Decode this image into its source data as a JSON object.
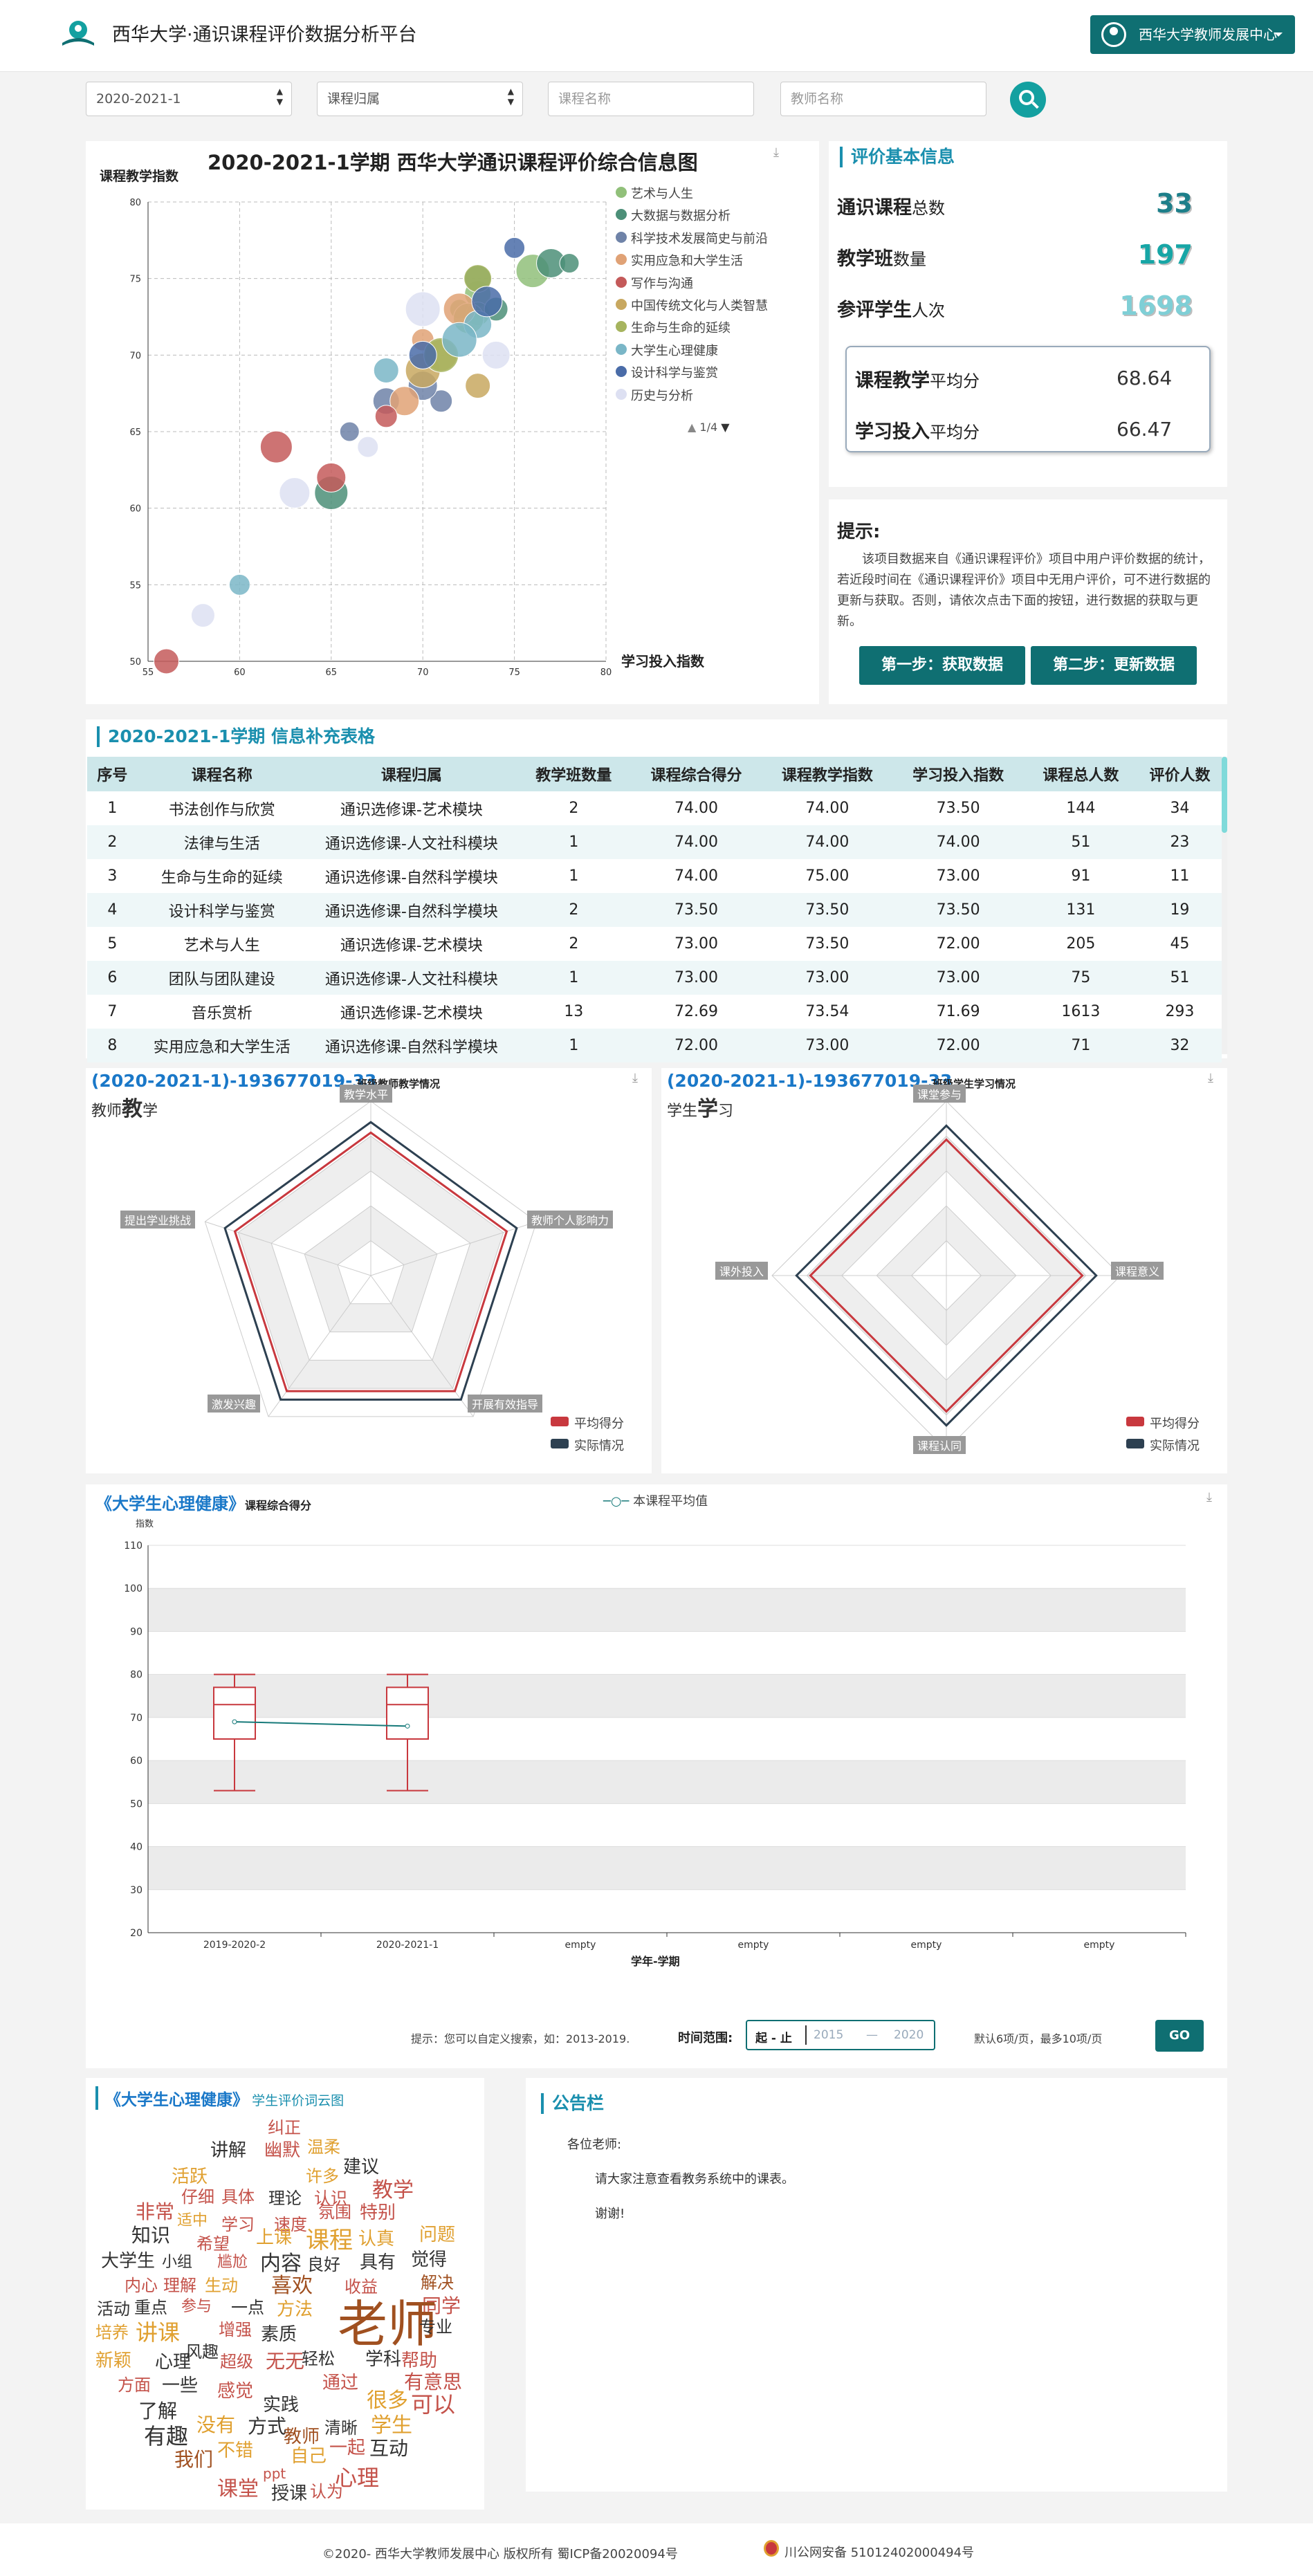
{
  "app": {
    "title": "西华大学·通识课程评价数据分析平台",
    "user_menu": "西华大学教师发展中心"
  },
  "filters": {
    "term": "2020-2021-1",
    "category": "课程归属",
    "course_placeholder": "课程名称",
    "teacher_placeholder": "教师名称"
  },
  "bubble": {
    "title": "2020-2021-1学期 西华大学通识课程评价综合信息图",
    "ylabel": "课程教学指数",
    "xlabel": "学习投入指数",
    "page": "1/4",
    "legend": [
      {
        "name": "艺术与人生",
        "color": "#91c07a"
      },
      {
        "name": "大数据与数据分析",
        "color": "#4c8f78"
      },
      {
        "name": "科学技术发展简史与前沿",
        "color": "#6f83a8"
      },
      {
        "name": "实用应急和大学生活",
        "color": "#e0a276"
      },
      {
        "name": "写作与沟通",
        "color": "#c45a5a"
      },
      {
        "name": "中国传统文化与人类智慧",
        "color": "#c8a860"
      },
      {
        "name": "生命与生命的延续",
        "color": "#a6b45e"
      },
      {
        "name": "大学生心理健康",
        "color": "#7ab6c7"
      },
      {
        "name": "设计科学与鉴赏",
        "color": "#4a6ca8"
      },
      {
        "name": "历史与分析",
        "color": "#dde0f2"
      }
    ],
    "xticks": [
      "55",
      "60",
      "65",
      "70",
      "75",
      "80"
    ],
    "yticks": [
      "50",
      "55",
      "60",
      "65",
      "70",
      "75",
      "80"
    ]
  },
  "chart_data": [
    {
      "type": "scatter",
      "title": "2020-2021-1学期 西华大学通识课程评价综合信息图",
      "xlabel": "学习投入指数",
      "ylabel": "课程教学指数",
      "xlim": [
        55,
        80
      ],
      "ylim": [
        50,
        80
      ],
      "series": [
        {
          "name": "艺术与人生",
          "values": [
            [
              72,
              73
            ],
            [
              73,
              74
            ],
            [
              76,
              75.5
            ],
            [
              73,
              72.7
            ],
            [
              72.5,
              72.4
            ]
          ]
        },
        {
          "name": "大数据与数据分析",
          "values": [
            [
              77,
              76
            ],
            [
              78,
              76
            ],
            [
              73,
              75
            ],
            [
              65,
              61
            ],
            [
              74,
              73
            ]
          ]
        },
        {
          "name": "科学技术发展简史与前沿",
          "values": [
            [
              71,
              67
            ],
            [
              70,
              68
            ],
            [
              66,
              65
            ],
            [
              68,
              67
            ]
          ]
        },
        {
          "name": "实用应急和大学生活",
          "values": [
            [
              72,
              73
            ],
            [
              70,
              71
            ],
            [
              69,
              67
            ]
          ]
        },
        {
          "name": "写作与沟通",
          "values": [
            [
              56,
              50
            ],
            [
              62,
              64
            ],
            [
              68,
              66
            ],
            [
              65,
              62
            ]
          ]
        },
        {
          "name": "中国传统文化与人类智慧",
          "values": [
            [
              70,
              69
            ],
            [
              73,
              68
            ],
            [
              71,
              70
            ]
          ]
        },
        {
          "name": "生命与生命的延续",
          "values": [
            [
              73,
              75
            ],
            [
              71,
              70
            ]
          ]
        },
        {
          "name": "大学生心理健康",
          "values": [
            [
              60,
              55
            ],
            [
              73,
              72
            ],
            [
              72,
              71
            ],
            [
              68,
              69
            ]
          ]
        },
        {
          "name": "设计科学与鉴赏",
          "values": [
            [
              73.5,
              73.5
            ],
            [
              75,
              77
            ],
            [
              70,
              70
            ]
          ]
        },
        {
          "name": "历史与分析",
          "values": [
            [
              58,
              53
            ],
            [
              63,
              61
            ],
            [
              67,
              64
            ],
            [
              74,
              70
            ],
            [
              70,
              73
            ]
          ]
        }
      ]
    },
    {
      "type": "radar",
      "title": "班级教师教学情况",
      "indicators": [
        "教学水平",
        "教师个人影响力",
        "开展有效指导",
        "激发兴趣",
        "提出学业挑战"
      ],
      "series": [
        {
          "name": "平均得分",
          "values": [
            0.82,
            0.82,
            0.82,
            0.82,
            0.82
          ]
        },
        {
          "name": "实际情况",
          "values": [
            0.88,
            0.88,
            0.88,
            0.88,
            0.88
          ]
        }
      ]
    },
    {
      "type": "radar",
      "title": "班级学生学习情况",
      "indicators": [
        "课堂参与",
        "课程意义",
        "课程认同",
        "课外投入"
      ],
      "series": [
        {
          "name": "平均得分",
          "values": [
            0.78,
            0.78,
            0.78,
            0.78
          ]
        },
        {
          "name": "实际情况",
          "values": [
            0.86,
            0.86,
            0.86,
            0.86
          ]
        }
      ]
    },
    {
      "type": "box",
      "title": "课程综合得分",
      "categories": [
        "2019-2020-2",
        "2020-2021-1",
        "empty",
        "empty",
        "empty",
        "empty"
      ],
      "ylim": [
        20,
        110
      ],
      "boxes": [
        {
          "min": 53,
          "q1": 65,
          "median": 73,
          "q3": 77,
          "max": 80
        },
        {
          "min": 53,
          "q1": 65,
          "median": 73,
          "q3": 77,
          "max": 80
        }
      ],
      "series": [
        {
          "name": "本课程平均值",
          "values": [
            69,
            68
          ]
        }
      ]
    }
  ],
  "basic_info": {
    "title": "评价基本信息",
    "rows": [
      {
        "label": "通识课程",
        "suffix": "总数",
        "value": "33",
        "color": "#1d7f8a"
      },
      {
        "label": "教学班",
        "suffix": "数量",
        "value": "197",
        "color": "#17a6a6"
      },
      {
        "label": "参评学生",
        "suffix": "人次",
        "value": "1698",
        "color": "#7fcfd6"
      }
    ],
    "avg": [
      {
        "label": "课程教学",
        "suffix": "平均分",
        "value": "68.64"
      },
      {
        "label": "学习投入",
        "suffix": "平均分",
        "value": "66.47"
      }
    ]
  },
  "tip": {
    "title": "提示:",
    "text": "该项目数据来自《通识课程评价》项目中用户评价数据的统计，若近段时间在《通识课程评价》项目中无用户评价，可不进行数据的更新与获取。否则，请依次点击下面的按钮，进行数据的获取与更新。",
    "btn1": "第一步：获取数据",
    "btn2": "第二步：更新数据"
  },
  "table": {
    "title": "2020-2021-1学期 信息补充表格",
    "headers": [
      "序号",
      "课程名称",
      "课程归属",
      "教学班数量",
      "课程综合得分",
      "课程教学指数",
      "学习投入指数",
      "课程总人数",
      "评价人数"
    ],
    "rows": [
      [
        "1",
        "书法创作与欣赏",
        "通识选修课-艺术模块",
        "2",
        "74.00",
        "74.00",
        "73.50",
        "144",
        "34"
      ],
      [
        "2",
        "法律与生活",
        "通识选修课-人文社科模块",
        "1",
        "74.00",
        "74.00",
        "74.00",
        "51",
        "23"
      ],
      [
        "3",
        "生命与生命的延续",
        "通识选修课-自然科学模块",
        "1",
        "74.00",
        "75.00",
        "73.00",
        "91",
        "11"
      ],
      [
        "4",
        "设计科学与鉴赏",
        "通识选修课-自然科学模块",
        "2",
        "73.50",
        "73.50",
        "73.50",
        "131",
        "19"
      ],
      [
        "5",
        "艺术与人生",
        "通识选修课-艺术模块",
        "2",
        "73.00",
        "73.50",
        "72.00",
        "205",
        "45"
      ],
      [
        "6",
        "团队与团队建设",
        "通识选修课-人文社科模块",
        "1",
        "73.00",
        "73.00",
        "73.00",
        "75",
        "51"
      ],
      [
        "7",
        "音乐赏析",
        "通识选修课-艺术模块",
        "13",
        "72.69",
        "73.54",
        "71.69",
        "1613",
        "293"
      ],
      [
        "8",
        "实用应急和大学生活",
        "通识选修课-自然科学模块",
        "1",
        "72.00",
        "73.00",
        "72.00",
        "71",
        "32"
      ]
    ]
  },
  "radar1": {
    "title": "(2020-2021-1)-193677019-33",
    "subtitle": "班级教师教学情况",
    "caption_pre": "教师",
    "caption_big": "教",
    "caption_post": "学",
    "labels": [
      "教学水平",
      "教师个人影响力",
      "开展有效指导",
      "激发兴趣",
      "提出学业挑战"
    ]
  },
  "radar2": {
    "title": "(2020-2021-1)-193677019-33",
    "subtitle": "班级学生学习情况",
    "caption_pre": "学生",
    "caption_big": "学",
    "caption_post": "习",
    "labels": [
      "课堂参与",
      "课程意义",
      "课程认同",
      "课外投入"
    ]
  },
  "radar_legend": [
    {
      "name": "平均得分",
      "color": "#c8383e"
    },
    {
      "name": "实际情况",
      "color": "#2d4051"
    }
  ],
  "box": {
    "title": "《大学生心理健康》",
    "subtitle": "课程综合得分",
    "legend": "本课程平均值",
    "yunit": "指数",
    "xlabel": "学年-学期",
    "yticks": [
      "110",
      "100",
      "90",
      "80",
      "70",
      "60",
      "50",
      "40",
      "30",
      "20"
    ],
    "xcats": [
      "2019-2020-2",
      "2020-2021-1",
      "empty",
      "empty",
      "empty",
      "empty"
    ]
  },
  "range": {
    "hint": "提示：您可以自定义搜索，如：2013-2019.",
    "label": "时间范围:",
    "start_label": "起 - 止",
    "from_placeholder": "2015",
    "to_placeholder": "2020",
    "dash": "—",
    "page_hint": "默认6项/页，最多10项/页",
    "go": "GO"
  },
  "cloud": {
    "title": "《大学生心理健康》",
    "subtitle": "学生评价词云图",
    "words": [
      [
        "纠正",
        "#c4524a"
      ],
      [
        "讲解",
        "#333"
      ],
      [
        "温柔",
        "#e0a030"
      ],
      [
        "幽默",
        "#c4524a"
      ],
      [
        "建议",
        "#333"
      ],
      [
        "活跃",
        "#e0a030"
      ],
      [
        "许多",
        "#e0a030"
      ],
      [
        "教学",
        "#c4524a"
      ],
      [
        "仔细",
        "#c4524a"
      ],
      [
        "具体",
        "#c4524a"
      ],
      [
        "理论",
        "#333"
      ],
      [
        "认识",
        "#c4524a"
      ],
      [
        "非常",
        "#c4524a"
      ],
      [
        "氛围",
        "#c4524a"
      ],
      [
        "特别",
        "#c4524a"
      ],
      [
        "适中",
        "#e0a030"
      ],
      [
        "学习",
        "#c4524a"
      ],
      [
        "速度",
        "#c4524a"
      ],
      [
        "知识",
        "#333"
      ],
      [
        "问题",
        "#e0a030"
      ],
      [
        "希望",
        "#c4524a"
      ],
      [
        "上课",
        "#e0a030"
      ],
      [
        "课程",
        "#e0a030"
      ],
      [
        "认真",
        "#e0a030"
      ],
      [
        "大学生",
        "#333"
      ],
      [
        "小组",
        "#333"
      ],
      [
        "尴尬",
        "#c4524a"
      ],
      [
        "内容",
        "#333"
      ],
      [
        "良好",
        "#333"
      ],
      [
        "具有",
        "#333"
      ],
      [
        "觉得",
        "#333"
      ],
      [
        "内心",
        "#c4524a"
      ],
      [
        "理解",
        "#c4524a"
      ],
      [
        "生动",
        "#e0a030"
      ],
      [
        "喜欢",
        "#a05020"
      ],
      [
        "收益",
        "#c4524a"
      ],
      [
        "解决",
        "#a05020"
      ],
      [
        "活动",
        "#333"
      ],
      [
        "重点",
        "#333"
      ],
      [
        "参与",
        "#c4524a"
      ],
      [
        "一点",
        "#333"
      ],
      [
        "方法",
        "#e0a030"
      ],
      [
        "同学",
        "#c4524a"
      ],
      [
        "培养",
        "#e0a030"
      ],
      [
        "讲课",
        "#e0a030"
      ],
      [
        "增强",
        "#c4524a"
      ],
      [
        "素质",
        "#333"
      ],
      [
        "老师",
        "#a05020"
      ],
      [
        "专业",
        "#333"
      ],
      [
        "风趣",
        "#333"
      ],
      [
        "新颖",
        "#e0a030"
      ],
      [
        "心理",
        "#333"
      ],
      [
        "超级",
        "#c4524a"
      ],
      [
        "无无",
        "#c4524a"
      ],
      [
        "轻松",
        "#333"
      ],
      [
        "学科",
        "#333"
      ],
      [
        "帮助",
        "#c4524a"
      ],
      [
        "方面",
        "#c4524a"
      ],
      [
        "一些",
        "#333"
      ],
      [
        "感觉",
        "#c4524a"
      ],
      [
        "通过",
        "#c4524a"
      ],
      [
        "有意思",
        "#c4524a"
      ],
      [
        "了解",
        "#333"
      ],
      [
        "实践",
        "#333"
      ],
      [
        "很多",
        "#e0a030"
      ],
      [
        "可以",
        "#c4524a"
      ],
      [
        "没有",
        "#e0a030"
      ],
      [
        "方式",
        "#333"
      ],
      [
        "清晰",
        "#333"
      ],
      [
        "学生",
        "#e0a030"
      ],
      [
        "有趣",
        "#333"
      ],
      [
        "教师",
        "#a05020"
      ],
      [
        "一起",
        "#c4524a"
      ],
      [
        "不错",
        "#e0a030"
      ],
      [
        "自己",
        "#e0a030"
      ],
      [
        "互动",
        "#333"
      ],
      [
        "我们",
        "#a05020"
      ],
      [
        "ppt",
        "#c4524a"
      ],
      [
        "心理",
        "#c4524a"
      ],
      [
        "课堂",
        "#c4524a"
      ],
      [
        "授课",
        "#333"
      ],
      [
        "认为",
        "#c4524a"
      ]
    ]
  },
  "notice": {
    "title": "公告栏",
    "greet": "各位老师:",
    "line1": "请大家注意查看教务系统中的课表。",
    "line2": "谢谢!"
  },
  "footer": {
    "copy": "©2020-  西华大学教师发展中心   版权所有   蜀ICP备20020094号",
    "police": "川公网安备 51012402000494号"
  }
}
